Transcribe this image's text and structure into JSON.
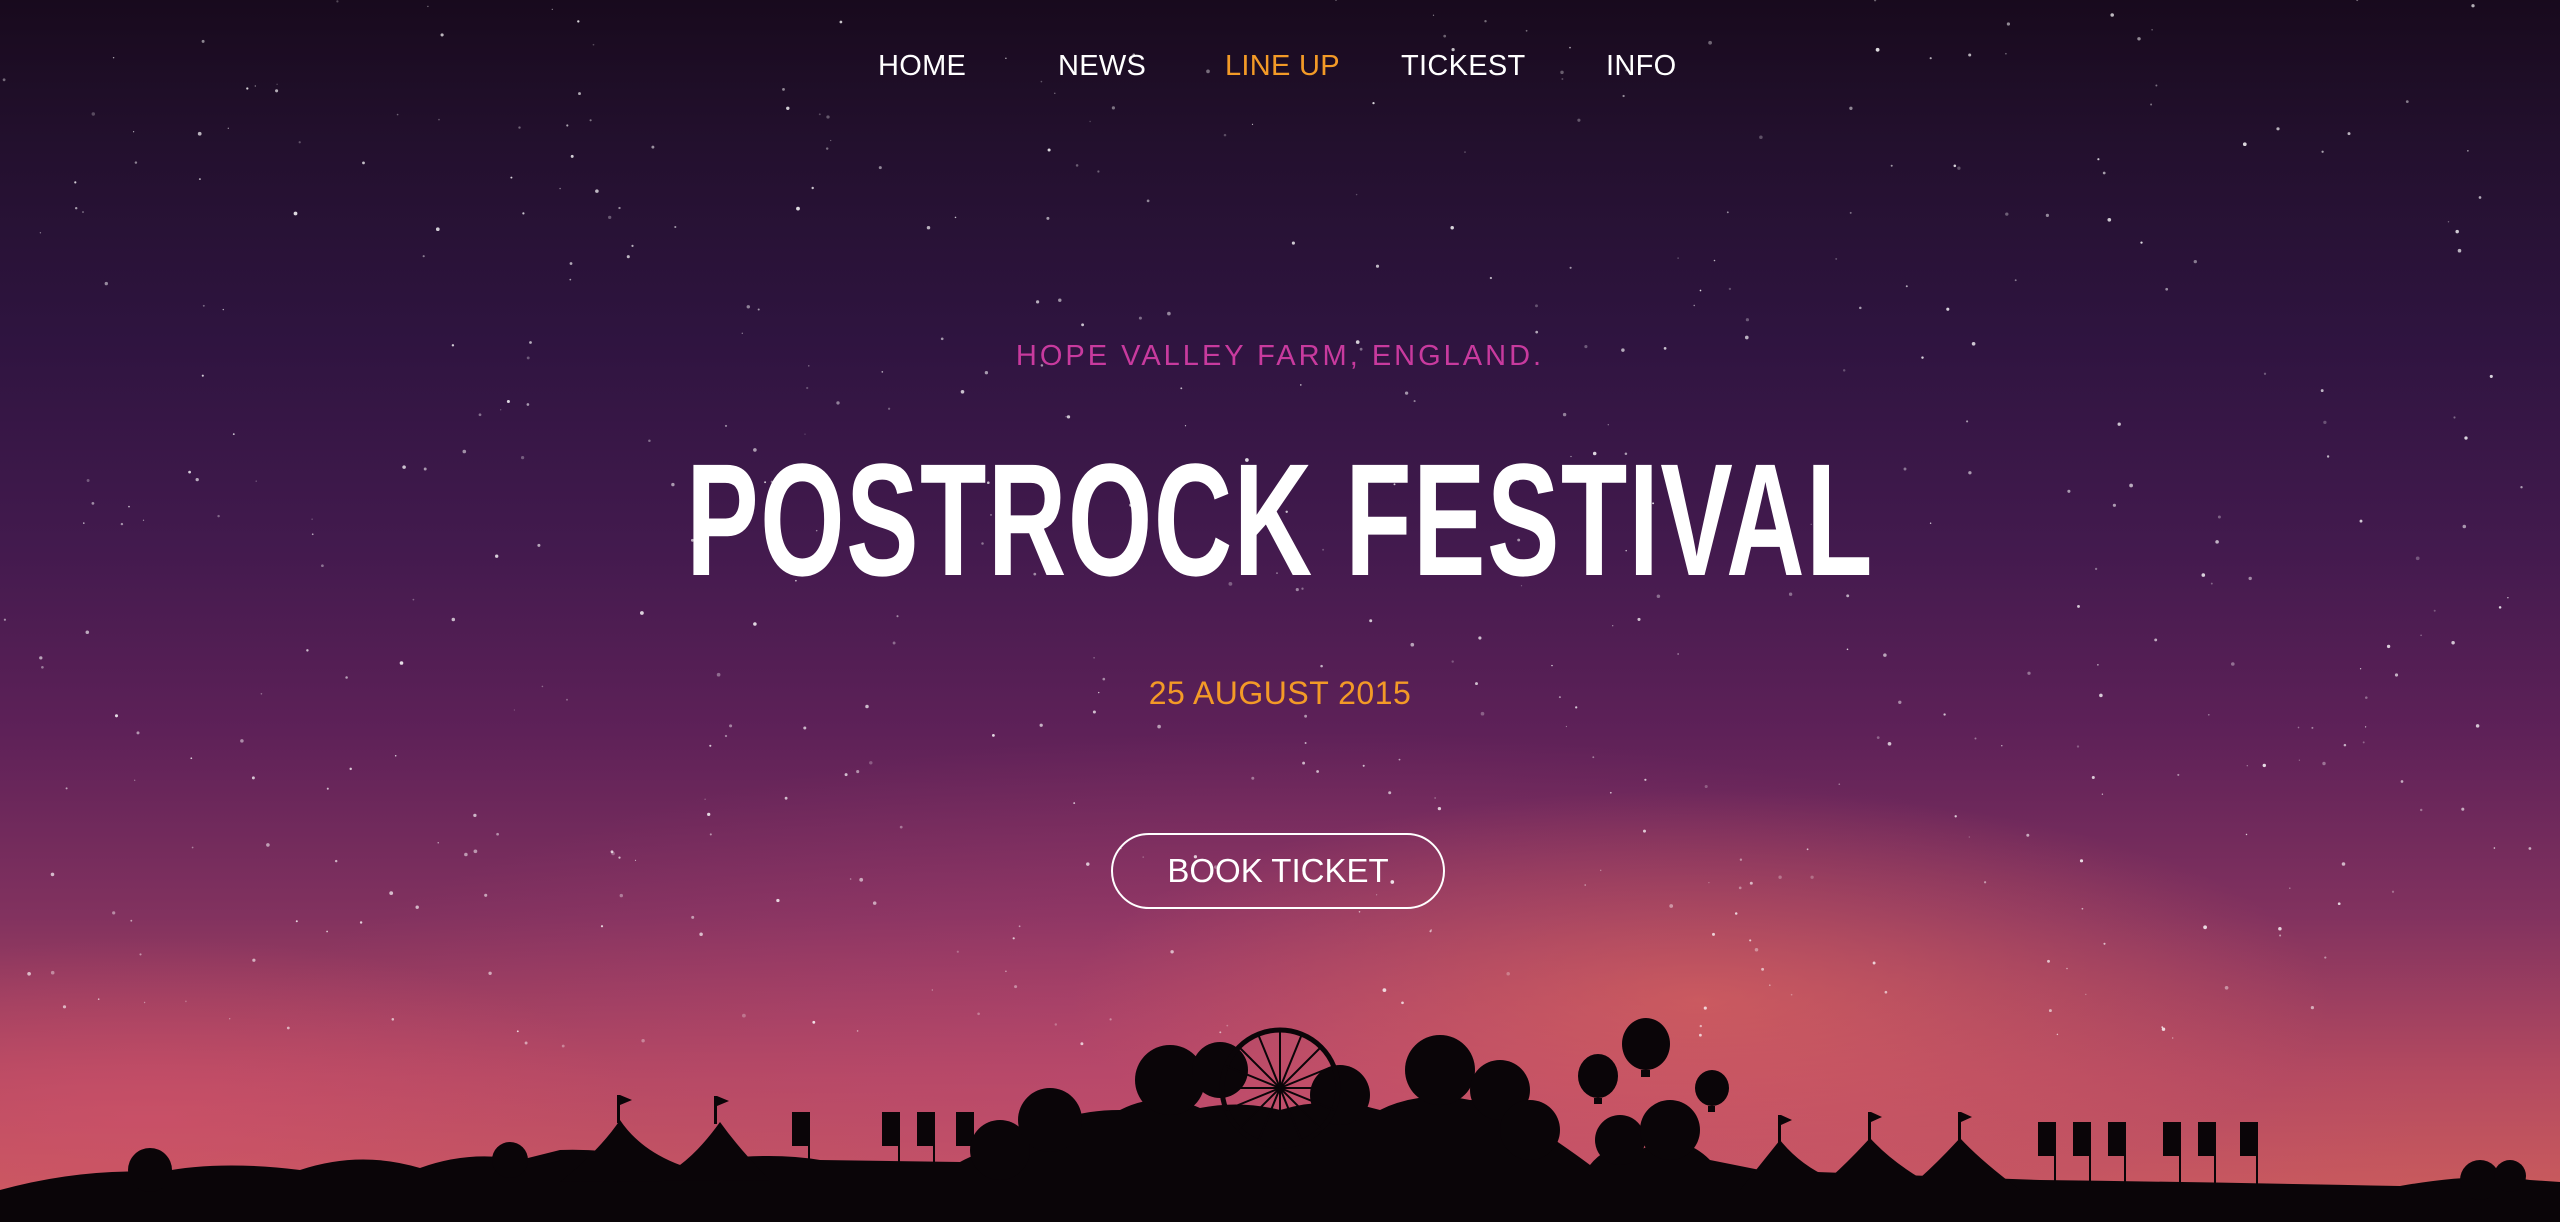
{
  "nav": {
    "items": [
      {
        "label": "HOME",
        "active": false
      },
      {
        "label": "NEWS",
        "active": false
      },
      {
        "label": "LINE UP",
        "active": true
      },
      {
        "label": "TICKEST",
        "active": false
      },
      {
        "label": "INFO",
        "active": false
      }
    ]
  },
  "hero": {
    "location": "HOPE VALLEY FARM, ENGLAND.",
    "title": "POSTROCK FESTIVAL",
    "date": "25 AUGUST 2015",
    "cta_label": "BOOK TICKET"
  },
  "colors": {
    "accent": "#f39a27",
    "location_text": "#c83a9e",
    "text": "#ffffff"
  }
}
